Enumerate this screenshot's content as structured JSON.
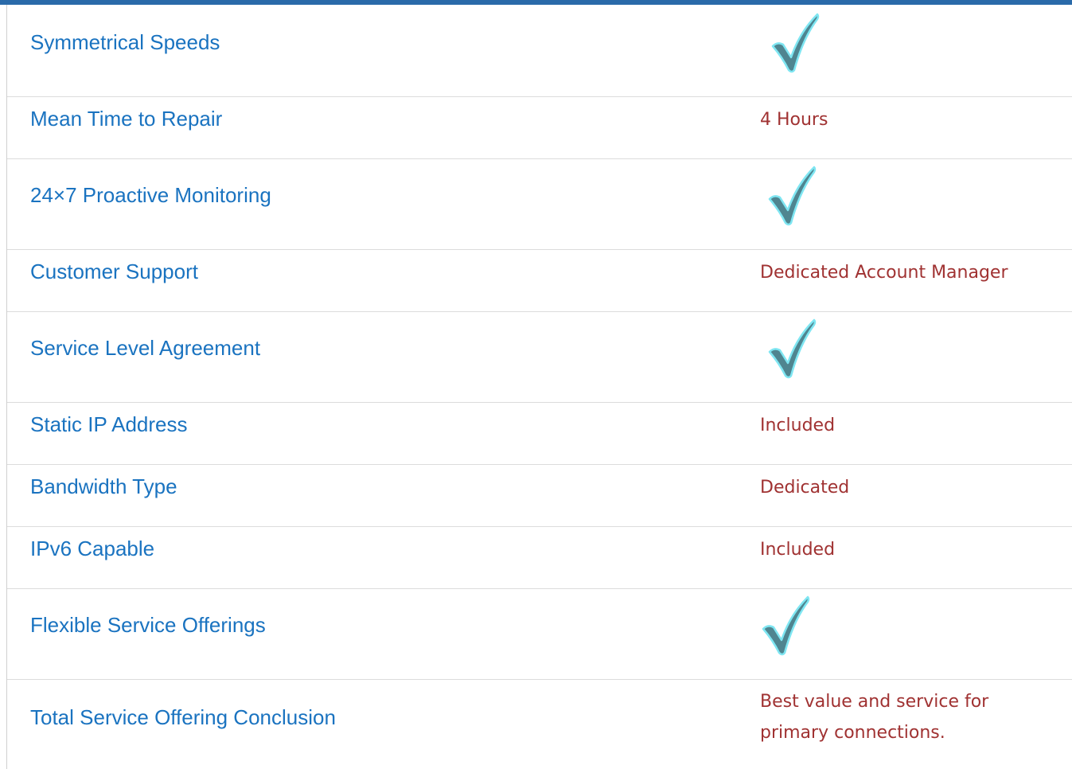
{
  "colors": {
    "top_bar": "#2a6aa9",
    "feature_text": "#1a73c0",
    "value_text": "#a03232",
    "check_fill": "#4f8590",
    "check_outline": "#7fe6f2",
    "divider": "#dcdcdc"
  },
  "rows": [
    {
      "feature": "Symmetrical Speeds",
      "value_type": "checkmark",
      "icon": "checkmark-icon"
    },
    {
      "feature": "Mean Time to Repair",
      "value_type": "text",
      "value": "4 Hours"
    },
    {
      "feature": "24×7 Proactive Monitoring",
      "value_type": "checkmark",
      "icon": "checkmark-icon"
    },
    {
      "feature": "Customer Support",
      "value_type": "text",
      "value": "Dedicated Account Manager"
    },
    {
      "feature": "Service Level Agreement",
      "value_type": "checkmark",
      "icon": "checkmark-icon"
    },
    {
      "feature": "Static IP Address",
      "value_type": "text",
      "value": "Included"
    },
    {
      "feature": "Bandwidth Type",
      "value_type": "text",
      "value": "Dedicated"
    },
    {
      "feature": "IPv6 Capable",
      "value_type": "text",
      "value": "Included"
    },
    {
      "feature": "Flexible Service Offerings",
      "value_type": "checkmark",
      "icon": "checkmark-icon"
    },
    {
      "feature": "Total Service Offering Conclusion",
      "value_type": "text",
      "value_lines": [
        "Best value and service for",
        "primary connections."
      ]
    }
  ]
}
